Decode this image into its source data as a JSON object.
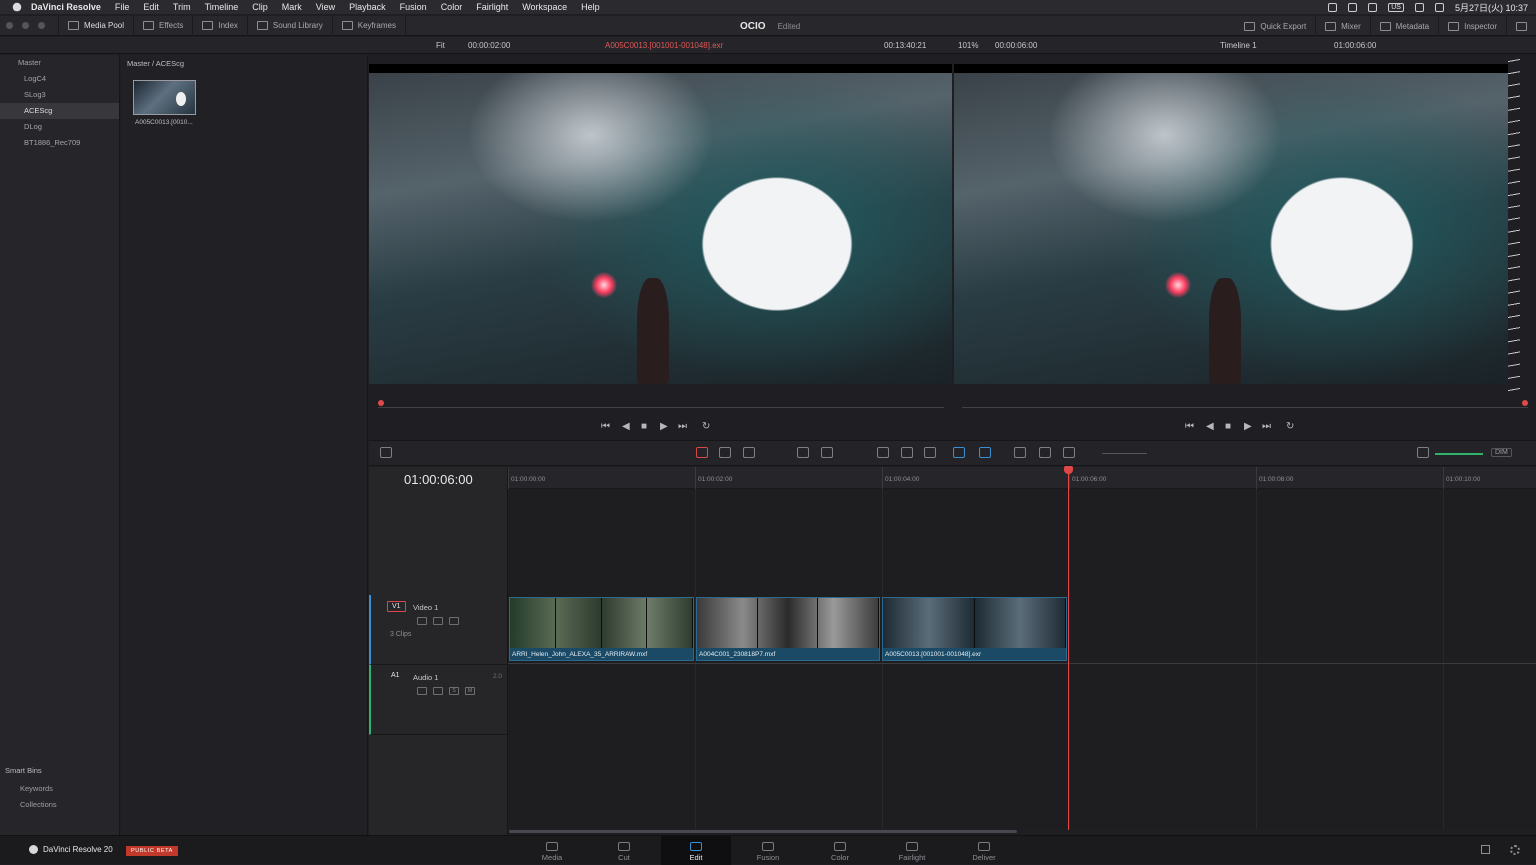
{
  "menubar": {
    "app": "DaVinci Resolve",
    "items": [
      "File",
      "Edit",
      "Trim",
      "Timeline",
      "Clip",
      "Mark",
      "View",
      "Playback",
      "Fusion",
      "Color",
      "Fairlight",
      "Workspace",
      "Help"
    ],
    "input_source": "US",
    "datetime": "5月27日(火)  10:37"
  },
  "toolbar": {
    "media_pool": "Media Pool",
    "effects": "Effects",
    "index": "Index",
    "sound_library": "Sound Library",
    "keyframes": "Keyframes",
    "project_title": "OCIO",
    "project_status": "Edited",
    "quick_export": "Quick Export",
    "mixer": "Mixer",
    "metadata": "Metadata",
    "inspector": "Inspector"
  },
  "source_viewer": {
    "zoom": "Fit",
    "duration": "00:00:02:00",
    "clip_name": "A005C0013.[001001-001048].exr",
    "timecode": "00:13:40:21"
  },
  "timeline_viewer": {
    "zoom": "101%",
    "duration": "00:00:06:00",
    "timeline_name": "Timeline 1",
    "timecode": "01:00:06:00"
  },
  "bins": {
    "master": "Master",
    "items": [
      "LogC4",
      "SLog3",
      "ACEScg",
      "DLog",
      "BT1886_Rec709"
    ],
    "selected": "ACEScg"
  },
  "smart_bins": {
    "title": "Smart Bins",
    "keywords": "Keywords",
    "collections": "Collections"
  },
  "media_pool": {
    "breadcrumb": "Master / ACEScg",
    "clip_label": "A005C0013.[0010..."
  },
  "timeline": {
    "timecode": "01:00:06:00",
    "ruler": [
      "01:00:00:00",
      "01:00:02:00",
      "01:00:04:00",
      "01:00:06:00",
      "01:00:08:00",
      "01:00:10:00"
    ],
    "video_track": {
      "id": "V1",
      "name": "Video 1",
      "clips_count": "3 Clips"
    },
    "audio_track": {
      "id": "A1",
      "name": "Audio 1",
      "channels": "2.0"
    },
    "clips": [
      {
        "name": "ARRI_Helen_John_ALEXA_35_ARRIRAW.mxf"
      },
      {
        "name": "A004C001_230818P7.mxf"
      },
      {
        "name": "A005C0013.[001001-001048].exr"
      }
    ],
    "dim_label": "DIM",
    "audio_solo": "S",
    "audio_mute": "M"
  },
  "pages": [
    "Media",
    "Cut",
    "Edit",
    "Fusion",
    "Color",
    "Fairlight",
    "Deliver"
  ],
  "active_page": "Edit",
  "brand": {
    "name": "DaVinci Resolve 20",
    "badge": "PUBLIC BETA"
  },
  "colors": {
    "accent": "#3a8fd0",
    "playhead": "#e04848",
    "clip": "#1b4a66",
    "beta": "#c0392b"
  }
}
